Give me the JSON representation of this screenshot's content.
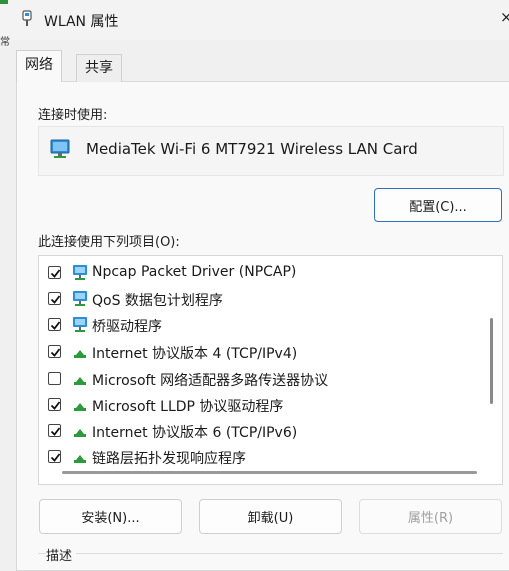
{
  "window": {
    "title": "WLAN 属性",
    "icon": "network-adapter-icon",
    "close_glyph": "×",
    "left_fragment": "常"
  },
  "tabs": [
    {
      "label": "网络",
      "active": true
    },
    {
      "label": "共享",
      "active": false
    }
  ],
  "connect_using": {
    "label": "连接时使用:",
    "adapter_name": "MediaTek Wi-Fi 6 MT7921 Wireless LAN Card",
    "configure_button": "配置(C)..."
  },
  "items_section": {
    "label": "此连接使用下列项目(O):",
    "items": [
      {
        "label": "Npcap Packet Driver (NPCAP)",
        "checked": true,
        "icon": "network-service-icon"
      },
      {
        "label": "QoS 数据包计划程序",
        "checked": true,
        "icon": "network-service-icon"
      },
      {
        "label": "桥驱动程序",
        "checked": true,
        "icon": "network-service-icon"
      },
      {
        "label": "Internet 协议版本 4 (TCP/IPv4)",
        "checked": true,
        "icon": "protocol-icon"
      },
      {
        "label": "Microsoft 网络适配器多路传送器协议",
        "checked": false,
        "icon": "protocol-icon"
      },
      {
        "label": "Microsoft LLDP 协议驱动程序",
        "checked": true,
        "icon": "protocol-icon"
      },
      {
        "label": "Internet 协议版本 6 (TCP/IPv6)",
        "checked": true,
        "icon": "protocol-icon"
      },
      {
        "label": "链路层拓扑发现响应程序",
        "checked": true,
        "icon": "protocol-icon"
      }
    ]
  },
  "buttons": {
    "install": "安装(N)...",
    "uninstall": "卸载(U)",
    "properties": "属性(R)"
  },
  "description": {
    "label": "描述"
  },
  "colors": {
    "accent": "#2e6fc0",
    "monitor_blue": "#2a8fd6",
    "protocol_green": "#2b9a3b"
  }
}
